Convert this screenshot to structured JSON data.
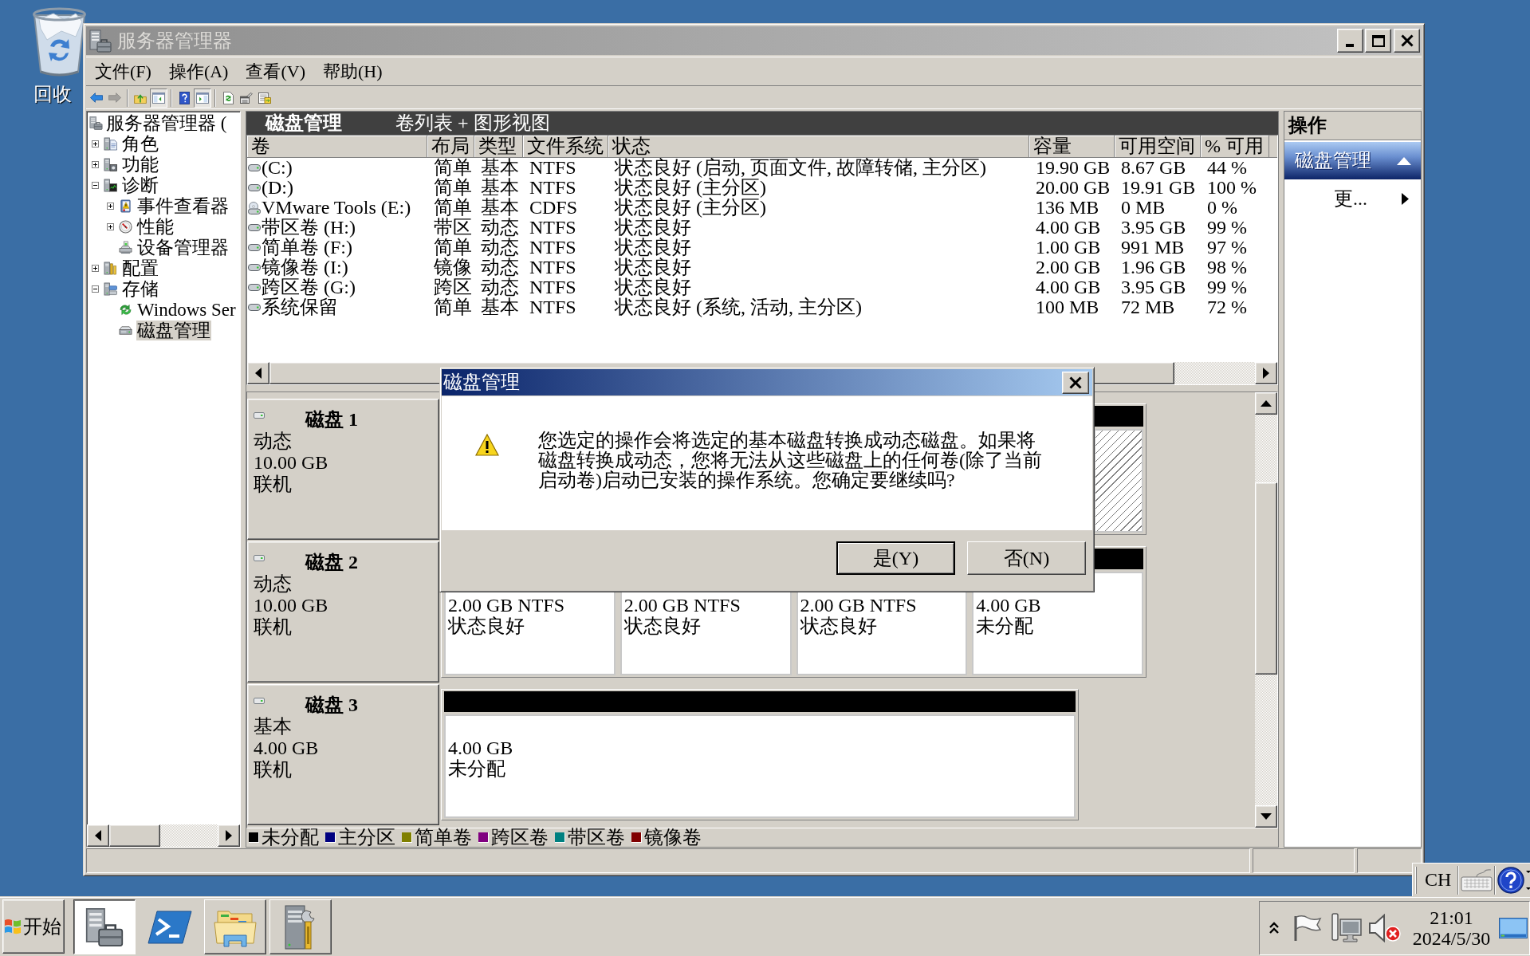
{
  "desktop_icons": [
    {
      "label": "回收"
    }
  ],
  "window": {
    "title": "服务器管理器",
    "active": false,
    "menu": [
      "文件(F)",
      "操作(A)",
      "查看(V)",
      "帮助(H)"
    ],
    "toolbar": [
      {
        "buttons": [
          {
            "kind": "back",
            "on": false,
            "disabled": false
          },
          {
            "kind": "forward",
            "on": false,
            "disabled": true
          }
        ]
      },
      {
        "buttons": [
          {
            "kind": "up",
            "on": false,
            "disabled": false
          },
          {
            "kind": "tree",
            "on": true,
            "disabled": false
          }
        ]
      },
      {
        "buttons": [
          {
            "kind": "help",
            "on": false,
            "disabled": false
          },
          {
            "kind": "pane",
            "on": true,
            "disabled": false
          }
        ]
      },
      {
        "buttons": [
          {
            "kind": "refresh",
            "on": false,
            "disabled": false
          },
          {
            "kind": "properties",
            "on": false,
            "disabled": false
          },
          {
            "kind": "export",
            "on": false,
            "disabled": false
          }
        ]
      }
    ],
    "tree": [
      {
        "label": "服务器管理器 (",
        "kind": "server",
        "selected": false,
        "children": [
          {
            "label": "角色",
            "kind": "roles",
            "selected": false,
            "expanded": false
          },
          {
            "label": "功能",
            "kind": "features",
            "selected": false,
            "expanded": false
          },
          {
            "label": "诊断",
            "kind": "diagnostics",
            "selected": false,
            "expanded": true,
            "children": [
              {
                "label": "事件查看器",
                "kind": "events",
                "selected": false,
                "expanded": false
              },
              {
                "label": "性能",
                "kind": "performance",
                "selected": false,
                "expanded": false
              },
              {
                "label": "设备管理器",
                "kind": "devices",
                "selected": false
              }
            ]
          },
          {
            "label": "配置",
            "kind": "configuration",
            "selected": false,
            "expanded": false
          },
          {
            "label": "存储",
            "kind": "storage",
            "selected": false,
            "expanded": true,
            "children": [
              {
                "label": "Windows Ser",
                "kind": "backup",
                "selected": false
              },
              {
                "label": "磁盘管理",
                "kind": "disk",
                "selected": true
              }
            ]
          }
        ]
      }
    ],
    "console": {
      "title": "磁盘管理",
      "view": "卷列表 + 图形视图",
      "columns": [
        "卷",
        "布局",
        "类型",
        "文件系统",
        "状态",
        "容量",
        "可用空间",
        "% 可用"
      ],
      "rows": [
        {
          "kind": "disk",
          "cells": [
            "(C:)",
            "简单",
            "基本",
            "NTFS",
            "状态良好 (启动, 页面文件, 故障转储, 主分区)",
            "19.90 GB",
            "8.67 GB",
            "44 %"
          ]
        },
        {
          "kind": "disk",
          "cells": [
            "(D:)",
            "简单",
            "基本",
            "NTFS",
            "状态良好 (主分区)",
            "20.00 GB",
            "19.91 GB",
            "100 %"
          ]
        },
        {
          "kind": "cd",
          "cells": [
            "VMware Tools (E:)",
            "简单",
            "基本",
            "CDFS",
            "状态良好 (主分区)",
            "136 MB",
            "0 MB",
            "0 %"
          ]
        },
        {
          "kind": "disk",
          "cells": [
            "带区卷 (H:)",
            "带区",
            "动态",
            "NTFS",
            "状态良好",
            "4.00 GB",
            "3.95 GB",
            "99 %"
          ]
        },
        {
          "kind": "disk",
          "cells": [
            "简单卷 (F:)",
            "简单",
            "动态",
            "NTFS",
            "状态良好",
            "1.00 GB",
            "991 MB",
            "97 %"
          ]
        },
        {
          "kind": "disk",
          "cells": [
            "镜像卷 (I:)",
            "镜像",
            "动态",
            "NTFS",
            "状态良好",
            "2.00 GB",
            "1.96 GB",
            "98 %"
          ]
        },
        {
          "kind": "disk",
          "cells": [
            "跨区卷 (G:)",
            "跨区",
            "动态",
            "NTFS",
            "状态良好",
            "4.00 GB",
            "3.95 GB",
            "99 %"
          ]
        },
        {
          "kind": "disk",
          "cells": [
            "系统保留",
            "简单",
            "基本",
            "NTFS",
            "状态良好 (系统, 活动, 主分区)",
            "100 MB",
            "72 MB",
            "72 %"
          ]
        }
      ],
      "disks": [
        {
          "name": "磁盘 1",
          "type": "动态",
          "size": "10.00 GB",
          "status": "联机",
          "partitions": [
            {
              "selected": true,
              "color": "#000000"
            }
          ]
        },
        {
          "name": "磁盘 2",
          "type": "动态",
          "size": "10.00 GB",
          "status": "联机",
          "partitions": [
            {
              "size": "2.00 GB NTFS",
              "status": "状态良好",
              "selected": false
            },
            {
              "size": "2.00 GB NTFS",
              "status": "状态良好",
              "selected": false
            },
            {
              "size": "2.00 GB NTFS",
              "status": "状态良好",
              "selected": false
            },
            {
              "size": "4.00 GB",
              "status": "未分配",
              "selected": false,
              "color": "#000000"
            }
          ]
        },
        {
          "name": "磁盘 3",
          "type": "基本",
          "size": "4.00 GB",
          "status": "联机",
          "partitions": [
            {
              "size": "4.00 GB",
              "status": "未分配",
              "selected": false,
              "color": "#000000"
            }
          ]
        }
      ],
      "legend": [
        {
          "label": "未分配",
          "color": "#000000"
        },
        {
          "label": "主分区",
          "color": "#000080"
        },
        {
          "label": "简单卷",
          "color": "#808000"
        },
        {
          "label": "跨区卷",
          "color": "#800080"
        },
        {
          "label": "带区卷",
          "color": "#008080"
        },
        {
          "label": "镜像卷",
          "color": "#800000"
        }
      ]
    },
    "actions": {
      "title": "操作",
      "sections": [
        {
          "title": "磁盘管理",
          "expanded": true,
          "items": [
            {
              "label": "更..."
            }
          ]
        }
      ]
    }
  },
  "dialog": {
    "title": "磁盘管理",
    "active": true,
    "message": "您选定的操作会将选定的基本磁盘转换成动态磁盘。如果将磁盘转换成动态，您将无法从这些磁盘上的任何卷(除了当前启动卷)启动已安装的操作系统。您确定要继续吗?",
    "buttons": [
      {
        "label": "是(Y)",
        "default": true
      },
      {
        "label": "否(N)",
        "default": false
      }
    ]
  },
  "language_bar": {
    "language": "CH"
  },
  "taskbar": {
    "start": "开始",
    "buttons": [
      {
        "kind": "server",
        "running": true,
        "selected": true
      },
      {
        "kind": "shell",
        "running": false,
        "selected": false
      },
      {
        "kind": "explorer",
        "running": true,
        "selected": false
      },
      {
        "kind": "tools",
        "running": true,
        "selected": false
      }
    ],
    "tray": {
      "muted": true,
      "time": "21:01",
      "date": "2024/5/30"
    }
  }
}
